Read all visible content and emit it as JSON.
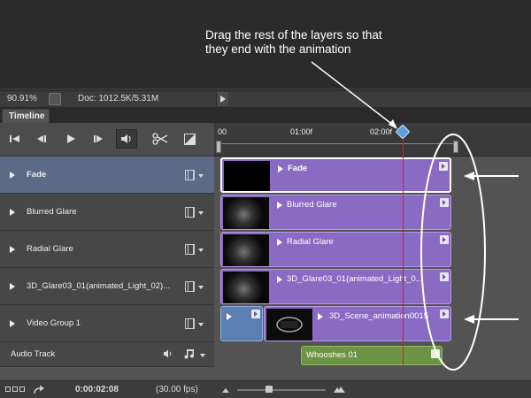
{
  "annotation": {
    "line1": "Drag the rest of the layers so that",
    "line2": "they end with the animation"
  },
  "status_bar": {
    "zoom": "90.91%",
    "doc_info": "Doc: 1012.5K/5.31M"
  },
  "panel": {
    "tab_label": "Timeline"
  },
  "ruler": {
    "labels": [
      "00",
      "01:00f",
      "02:00f"
    ]
  },
  "tracks": [
    {
      "label": "Fade",
      "clip": "Fade",
      "selected": true
    },
    {
      "label": "Blurred Glare",
      "clip": "Blurred Glare",
      "selected": false
    },
    {
      "label": "Radial Glare",
      "clip": "Radial Glare",
      "selected": false
    },
    {
      "label": "3D_Glare03_01(animated_Light_02)...",
      "clip": "3D_Glare03_01(animated_Light_0...",
      "selected": false
    },
    {
      "label": "Video Group 1",
      "clip": "3D_Scene_animation0015",
      "selected": false
    }
  ],
  "audio_track": {
    "label": "Audio Track",
    "clip": "Whooshes 01"
  },
  "bottom_bar": {
    "current_time": "0:00:02:08",
    "fps": "(30.00 fps)"
  },
  "colors": {
    "video_clip": "#8a6bc4",
    "audio_clip": "#6d9445",
    "group_clip": "#5b7fb1",
    "playhead": "#d0202a",
    "selected_track": "#5b6a85"
  },
  "icons": {
    "controls": [
      "go-to-first-frame-icon",
      "previous-frame-icon",
      "play-icon",
      "next-frame-icon",
      "audio-speaker-icon",
      "scissors-icon",
      "transition-icon"
    ],
    "track": [
      "expand-triangle-icon",
      "filmstrip-icon",
      "dropdown-arrow-icon"
    ],
    "audio": [
      "speaker-icon",
      "music-note-icon"
    ]
  }
}
